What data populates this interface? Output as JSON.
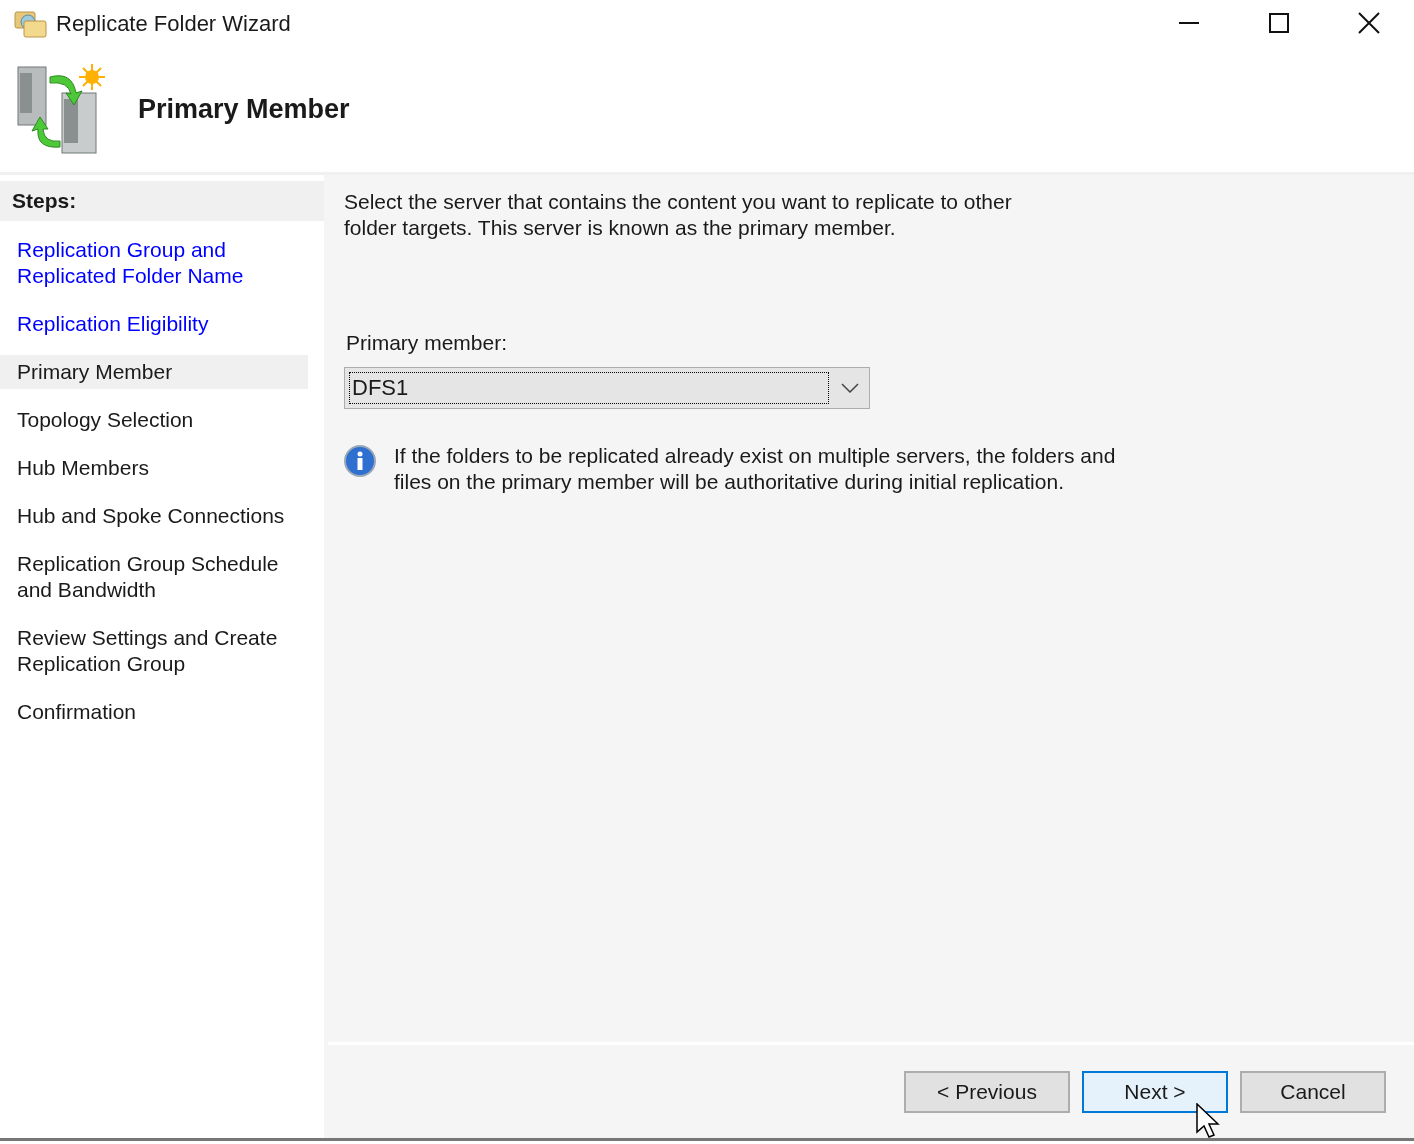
{
  "window": {
    "title": "Replicate Folder Wizard"
  },
  "header": {
    "title": "Primary Member"
  },
  "steps_heading": "Steps:",
  "steps": [
    {
      "label": "Replication Group and Replicated Folder Name",
      "kind": "completed"
    },
    {
      "label": "Replication Eligibility",
      "kind": "completed"
    },
    {
      "label": "Primary Member",
      "kind": "current"
    },
    {
      "label": "Topology Selection",
      "kind": "pending"
    },
    {
      "label": "Hub Members",
      "kind": "pending"
    },
    {
      "label": "Hub and Spoke Connections",
      "kind": "pending"
    },
    {
      "label": "Replication Group Schedule and Bandwidth",
      "kind": "pending"
    },
    {
      "label": "Review Settings and Create Replication Group",
      "kind": "pending"
    },
    {
      "label": "Confirmation",
      "kind": "pending"
    }
  ],
  "intro": "Select the server that contains the content you want to replicate to other folder targets. This server is known as the primary member.",
  "primary_member": {
    "label": "Primary member:",
    "value": "DFS1"
  },
  "info": "If the folders to be replicated already exist on multiple servers, the folders and files on the primary member will be authoritative during initial replication.",
  "buttons": [
    {
      "label": "< Previous",
      "focused": false
    },
    {
      "label": "Next >",
      "focused": true
    },
    {
      "label": "Cancel",
      "focused": false
    }
  ]
}
